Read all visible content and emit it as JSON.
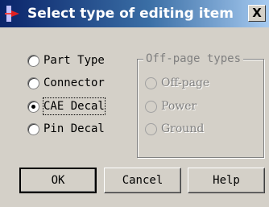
{
  "dialog": {
    "title": "Select type of editing item",
    "close_label": "X"
  },
  "item_types": [
    {
      "label": "Part Type",
      "selected": false
    },
    {
      "label": "Connector",
      "selected": false
    },
    {
      "label": "CAE Decal",
      "selected": true
    },
    {
      "label": "Pin Decal",
      "selected": false
    }
  ],
  "off_page_types": {
    "title": "Off-page types",
    "options": [
      {
        "label": "Off-page",
        "enabled": false
      },
      {
        "label": "Power",
        "enabled": false
      },
      {
        "label": "Ground",
        "enabled": false
      }
    ]
  },
  "buttons": {
    "ok": "OK",
    "cancel": "Cancel",
    "help": "Help"
  }
}
